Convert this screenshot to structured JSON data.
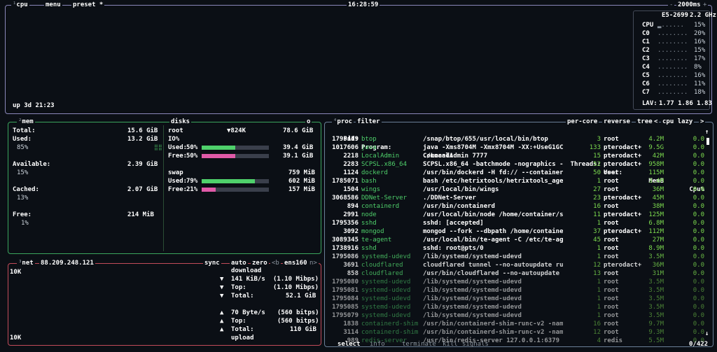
{
  "top": {
    "cpu": "cpu",
    "menu": "menu",
    "preset": "preset *",
    "clock": "16:28:59",
    "interval": "2000ms",
    "plus": "+",
    "minus": "-"
  },
  "cpu_box": {
    "uptime": "up 3d 21:23",
    "model": "E5-2699",
    "freq": "2.2 GHz",
    "cores": [
      {
        "label": "CPU",
        "val": "15%"
      },
      {
        "label": "C0",
        "val": "20%"
      },
      {
        "label": "C1",
        "val": "16%"
      },
      {
        "label": "C2",
        "val": "15%"
      },
      {
        "label": "C3",
        "val": "17%"
      },
      {
        "label": "C4",
        "val": "8%"
      },
      {
        "label": "C5",
        "val": "16%"
      },
      {
        "label": "C6",
        "val": "11%"
      },
      {
        "label": "C7",
        "val": "18%"
      }
    ],
    "lav_label": "LAV:",
    "lav": "1.77 1.86 1.83"
  },
  "mem": {
    "title": "mem",
    "total_label": "Total:",
    "total": "15.6 GiB",
    "used_label": "Used:",
    "used": "13.2 GiB",
    "used_pct": "85%",
    "avail_label": "Available:",
    "avail": "2.39 GiB",
    "avail_pct": "15%",
    "cached_label": "Cached:",
    "cached": "2.07 GiB",
    "cached_pct": "13%",
    "free_label": "Free:",
    "free": "214 MiB",
    "free_pct": "1%"
  },
  "disks": {
    "title": "disks",
    "io_label": "IO",
    "io_value": "o",
    "root_label": "root",
    "root_io": "▼824K",
    "root_total": "78.6 GiB",
    "io": "IO%",
    "root_used_label": "Used:",
    "root_used_pct": "50%",
    "root_used_pct_num": 50,
    "root_used": "39.4 GiB",
    "root_free_label": "Free:",
    "root_free_pct": "50%",
    "root_free_pct_num": 50,
    "root_free": "39.1 GiB",
    "swap_label": "swap",
    "swap_total": "759 MiB",
    "swap_used_label": "Used:",
    "swap_used_pct": "79%",
    "swap_used_pct_num": 79,
    "swap_used": "602 MiB",
    "swap_free_label": "Free:",
    "swap_free_pct": "21%",
    "swap_free_pct_num": 21,
    "swap_free": "157 MiB"
  },
  "net": {
    "title": "net",
    "ip": "88.209.248.121",
    "sync": "sync",
    "auto": "auto",
    "zero": "zero",
    "prev": "<b",
    "iface": "ens160",
    "next": "n>",
    "scale_top": "10K",
    "scale_bottom": "10K",
    "download": "download",
    "dl_rate_label": "141 KiB/s",
    "dl_rate_bits": "(1.10 Mibps)",
    "dl_top_label": "Top:",
    "dl_top": "(1.10 Mibps)",
    "dl_total_label": "Total:",
    "dl_total": "52.1 GiB",
    "ul_rate_label": "70 Byte/s",
    "ul_rate_bits": "(560 bitps)",
    "ul_top_label": "Top:",
    "ul_top": "(560 bitps)",
    "ul_total_label": "Total:",
    "ul_total": "110 GiB",
    "upload": "upload"
  },
  "proc": {
    "title": "proc",
    "filter": "filter",
    "per_core": "per-core",
    "reverse": "reverse",
    "tree": "tree",
    "sort": "cpu lazy",
    "sort_prev": "<",
    "sort_next": ">",
    "headers": {
      "pid": "Pid:",
      "program": "Program:",
      "command": "Command:",
      "threads": "Threads:",
      "user": "User:",
      "mem": "MemB",
      "cpu": "Cpu%"
    },
    "rows": [
      {
        "pid": "1795419",
        "program": "btop",
        "command": "/snap/btop/655/usr/local/bin/btop",
        "threads": "3",
        "user": "root",
        "mem": "4.2M",
        "cpu": "0.0"
      },
      {
        "pid": "1017606",
        "program": "java",
        "command": "java -Xms8704M -Xmx8704M -XX:+UseG1GC -XX:+",
        "threads": "133",
        "user": "pterodact+",
        "mem": "9.5G",
        "cpu": "0.0"
      },
      {
        "pid": "2218",
        "program": "LocalAdmin",
        "command": "./LocalAdmin 7777",
        "threads": "15",
        "user": "pterodact+",
        "mem": "42M",
        "cpu": "0.0"
      },
      {
        "pid": "2283",
        "program": "SCPSL.x86_64",
        "command": "SCPSL.x86_64 -batchmode -nographics -txbuff",
        "threads": "52",
        "user": "pterodact+",
        "mem": "958M",
        "cpu": "0.0"
      },
      {
        "pid": "1124",
        "program": "dockerd",
        "command": "/usr/bin/dockerd -H fd:// --containerd=/run",
        "threads": "50",
        "user": "root",
        "mem": "115M",
        "cpu": "0.0"
      },
      {
        "pid": "1785071",
        "program": "bash",
        "command": "bash /etc/hetrixtools/hetrixtools_agent.sh",
        "threads": "1",
        "user": "root",
        "mem": "3.4M",
        "cpu": "0.0"
      },
      {
        "pid": "1504",
        "program": "wings",
        "command": "/usr/local/bin/wings",
        "threads": "27",
        "user": "root",
        "mem": "36M",
        "cpu": "0.0"
      },
      {
        "pid": "3068586",
        "program": "DDNet-Server",
        "command": "./DDNet-Server",
        "threads": "23",
        "user": "pterodact+",
        "mem": "45M",
        "cpu": "0.0"
      },
      {
        "pid": "894",
        "program": "containerd",
        "command": "/usr/bin/containerd",
        "threads": "16",
        "user": "root",
        "mem": "38M",
        "cpu": "0.0"
      },
      {
        "pid": "2991",
        "program": "node",
        "command": "/usr/local/bin/node /home/container/server/",
        "threads": "11",
        "user": "pterodact+",
        "mem": "125M",
        "cpu": "0.0"
      },
      {
        "pid": "1795356",
        "program": "sshd",
        "command": "sshd: [accepted]",
        "threads": "1",
        "user": "root",
        "mem": "6.8M",
        "cpu": "0.0"
      },
      {
        "pid": "3092",
        "program": "mongod",
        "command": "mongod --fork --dbpath /home/container/mong",
        "threads": "37",
        "user": "pterodact+",
        "mem": "112M",
        "cpu": "0.0"
      },
      {
        "pid": "3089345",
        "program": "te-agent",
        "command": "/usr/local/bin/te-agent -C /etc/te-agent.cf",
        "threads": "45",
        "user": "root",
        "mem": "27M",
        "cpu": "0.0"
      },
      {
        "pid": "1738916",
        "program": "sshd",
        "command": "sshd: root@pts/0",
        "threads": "1",
        "user": "root",
        "mem": "8.9M",
        "cpu": "0.0"
      },
      {
        "pid": "1795086",
        "program": "systemd-udevd",
        "command": "/lib/systemd/systemd-udevd",
        "threads": "1",
        "user": "root",
        "mem": "3.5M",
        "cpu": "0.0"
      },
      {
        "pid": "3691",
        "program": "cloudflared",
        "command": "cloudflared tunnel --no-autoupdate run --to",
        "threads": "12",
        "user": "pterodact+",
        "mem": "36M",
        "cpu": "0.0"
      },
      {
        "pid": "858",
        "program": "cloudflared",
        "command": "/usr/bin/cloudflared --no-autoupdate tunnel",
        "threads": "13",
        "user": "root",
        "mem": "31M",
        "cpu": "0.0"
      },
      {
        "pid": "1795080",
        "program": "systemd-udevd",
        "command": "/lib/systemd/systemd-udevd",
        "threads": "1",
        "user": "root",
        "mem": "3.5M",
        "cpu": "0.0"
      },
      {
        "pid": "1795081",
        "program": "systemd-udevd",
        "command": "/lib/systemd/systemd-udevd",
        "threads": "1",
        "user": "root",
        "mem": "3.5M",
        "cpu": "0.0"
      },
      {
        "pid": "1795084",
        "program": "systemd-udevd",
        "command": "/lib/systemd/systemd-udevd",
        "threads": "1",
        "user": "root",
        "mem": "3.5M",
        "cpu": "0.0"
      },
      {
        "pid": "1795085",
        "program": "systemd-udevd",
        "command": "/lib/systemd/systemd-udevd",
        "threads": "1",
        "user": "root",
        "mem": "3.5M",
        "cpu": "0.0"
      },
      {
        "pid": "1795079",
        "program": "systemd-udevd",
        "command": "/lib/systemd/systemd-udevd",
        "threads": "1",
        "user": "root",
        "mem": "3.5M",
        "cpu": "0.0"
      },
      {
        "pid": "1838",
        "program": "containerd-shim",
        "command": "/usr/bin/containerd-shim-runc-v2 -namespace",
        "threads": "16",
        "user": "root",
        "mem": "9.7M",
        "cpu": "0.0"
      },
      {
        "pid": "3114",
        "program": "containerd-shim",
        "command": "/usr/bin/containerd-shim-runc-v2 -namespace",
        "threads": "12",
        "user": "root",
        "mem": "9.3M",
        "cpu": "0.0"
      },
      {
        "pid": "989",
        "program": "redis-server",
        "command": "/usr/bin/redis-server 127.0.0.1:6379",
        "threads": "4",
        "user": "redis",
        "mem": "5.5M",
        "cpu": "0.0"
      }
    ],
    "footer": {
      "select": "select",
      "info": "info",
      "terminate": "terminate",
      "kill": "kill",
      "signals": "signals",
      "count": "0/422"
    }
  },
  "colors": {
    "cpu_border": "#8a87b9",
    "mem_border": "#3ba55d",
    "net_border": "#c24b5a",
    "proc_border": "#6a7f97",
    "accent_green": "#4fd16b",
    "accent_pink": "#e05aa8"
  }
}
